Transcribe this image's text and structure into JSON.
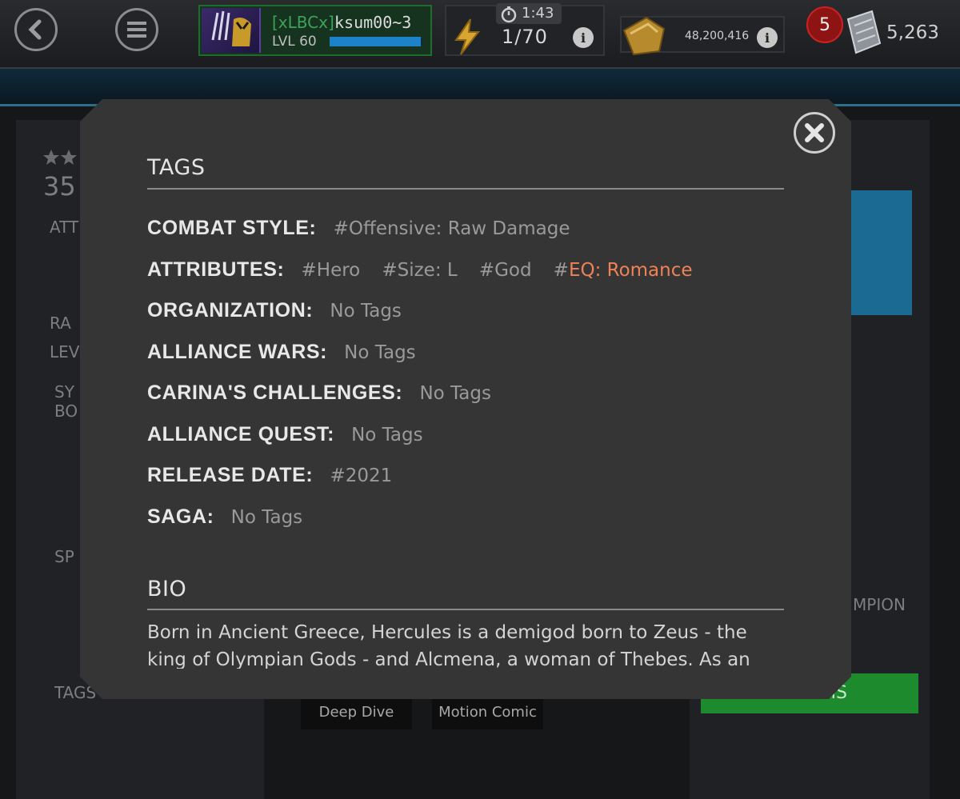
{
  "top_bar": {
    "alliance_tag": "[xLBCx]",
    "player_name": "ksum00~3",
    "level_label": "LVL 60",
    "xp_fraction": 0.98,
    "timer": "1:43",
    "energy": "1/70",
    "gold": "48,200,416",
    "notification_count": "5",
    "units": "5,263",
    "icons": [
      "back-arrow-icon",
      "menu-icon",
      "lightning-icon",
      "stopwatch-icon",
      "gold-icon",
      "units-icon",
      "info-icon"
    ]
  },
  "background": {
    "stars_partial": "35",
    "left_labels": [
      "ATT",
      "RA",
      "LEV",
      "SY",
      "BO",
      "SP",
      "TAGS"
    ],
    "right_label": "MPION",
    "right_button": "MS",
    "bottom_buttons": [
      "Deep Dive",
      "Motion Comic"
    ]
  },
  "modal": {
    "tags_title": "TAGS",
    "tag_rows": [
      {
        "key": "COMBAT STYLE:",
        "values": [
          "#Offensive: Raw Damage"
        ]
      },
      {
        "key": "ATTRIBUTES:",
        "values": [
          "#Hero",
          "#Size: L",
          "#God",
          "#EQ: Romance"
        ]
      },
      {
        "key": "ORGANIZATION:",
        "values": [
          "No Tags"
        ]
      },
      {
        "key": "ALLIANCE WARS:",
        "values": [
          "No Tags"
        ]
      },
      {
        "key": "CARINA'S CHALLENGES:",
        "values": [
          "No Tags"
        ]
      },
      {
        "key": "ALLIANCE QUEST:",
        "values": [
          "No Tags"
        ]
      },
      {
        "key": "RELEASE DATE:",
        "values": [
          "#2021"
        ]
      },
      {
        "key": "SAGA:",
        "values": [
          "No Tags"
        ]
      }
    ],
    "highlight_value": "EQ: Romance",
    "bio_title": "BIO",
    "bio_text": "Born in Ancient Greece, Hercules is a demigod born to Zeus - the king of Olympian Gods - and Alcmena, a woman of Thebes. As an",
    "close_icon": "close-icon"
  },
  "colors": {
    "modal_bg": "#353535",
    "highlight": "#ef8255",
    "tag_value": "#9a9a9a"
  }
}
